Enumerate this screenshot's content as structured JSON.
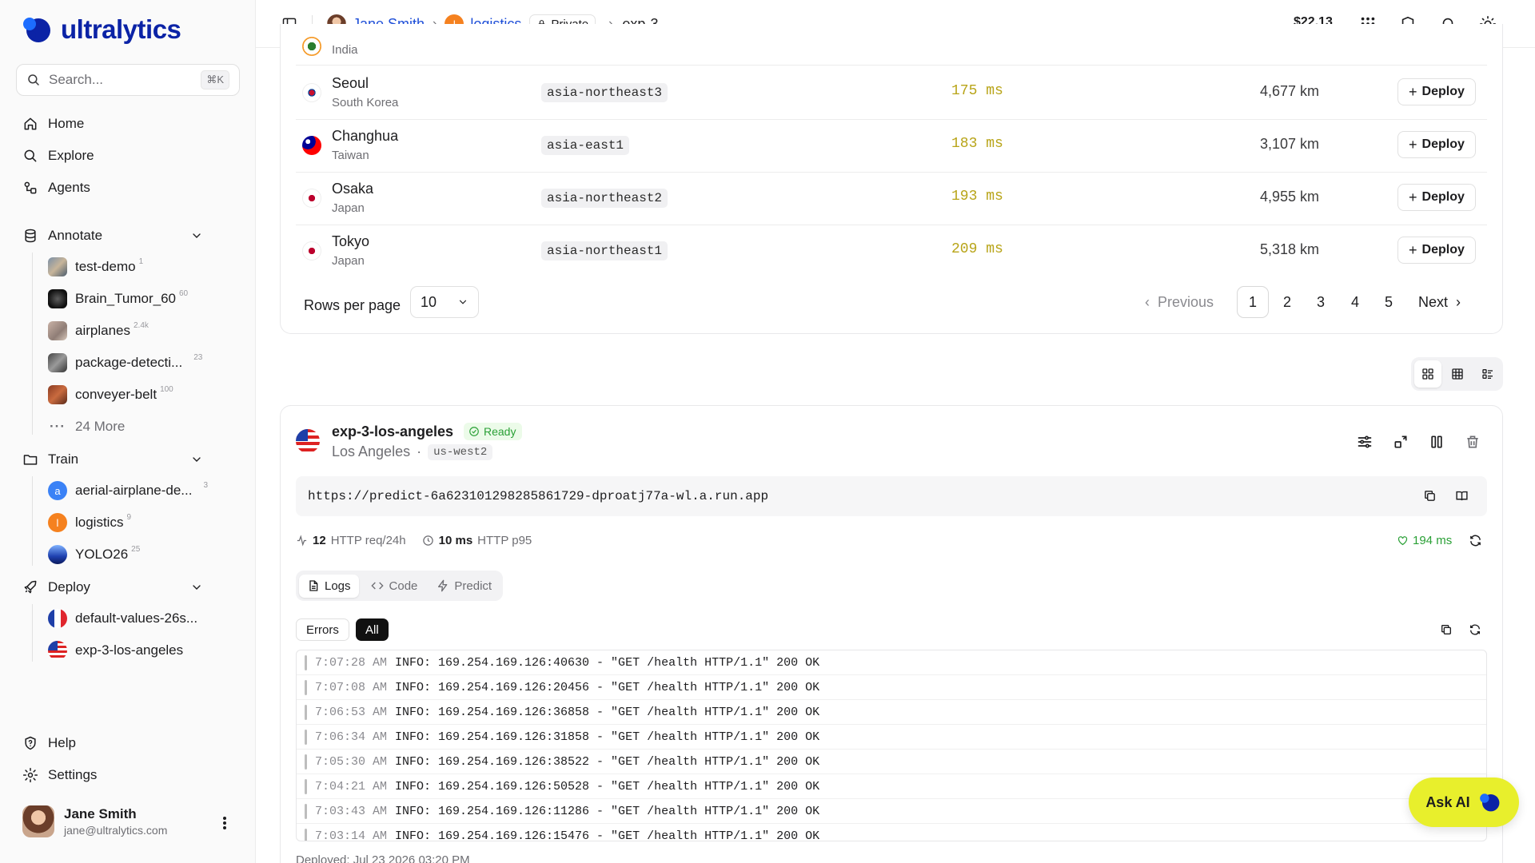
{
  "brand": {
    "name": "ultralytics"
  },
  "search": {
    "placeholder": "Search...",
    "shortcut": "⌘K"
  },
  "nav": {
    "home": "Home",
    "explore": "Explore",
    "agents": "Agents",
    "annotate": "Annotate",
    "train": "Train",
    "deploy": "Deploy",
    "help": "Help",
    "settings": "Settings"
  },
  "annotate_items": [
    {
      "label": "test-demo",
      "count": "1"
    },
    {
      "label": "Brain_Tumor_60",
      "count": "60"
    },
    {
      "label": "airplanes",
      "count": "2.4k"
    },
    {
      "label": "package-detecti...",
      "count": "23"
    },
    {
      "label": "conveyer-belt",
      "count": "100"
    },
    {
      "label": "24 More",
      "count": ""
    }
  ],
  "train_items": [
    {
      "label": "aerial-airplane-de...",
      "count": "3",
      "initial": "a"
    },
    {
      "label": "logistics",
      "count": "9",
      "initial": "l"
    },
    {
      "label": "YOLO26",
      "count": "25",
      "initial": ""
    }
  ],
  "deploy_items": [
    {
      "label": "default-values-26s..."
    },
    {
      "label": "exp-3-los-angeles"
    }
  ],
  "user": {
    "name": "Jane Smith",
    "email": "jane@ultralytics.com"
  },
  "breadcrumb": {
    "user": "Jane Smith",
    "project": "logistics",
    "project_initial": "l",
    "visibility": "Private",
    "current": "exp-3"
  },
  "topbar": {
    "balance": "$22.13"
  },
  "regions": [
    {
      "city": "",
      "country": "India",
      "zone": "",
      "latency": "",
      "distance": "",
      "deploy": "Deploy"
    },
    {
      "city": "Seoul",
      "country": "South Korea",
      "zone": "asia-northeast3",
      "latency": "175 ms",
      "distance": "4,677 km",
      "deploy": "Deploy"
    },
    {
      "city": "Changhua",
      "country": "Taiwan",
      "zone": "asia-east1",
      "latency": "183 ms",
      "distance": "3,107 km",
      "deploy": "Deploy"
    },
    {
      "city": "Osaka",
      "country": "Japan",
      "zone": "asia-northeast2",
      "latency": "193 ms",
      "distance": "4,955 km",
      "deploy": "Deploy"
    },
    {
      "city": "Tokyo",
      "country": "Japan",
      "zone": "asia-northeast1",
      "latency": "209 ms",
      "distance": "5,318 km",
      "deploy": "Deploy"
    }
  ],
  "pagination": {
    "rows_label": "Rows per page",
    "rows_value": "10",
    "previous": "Previous",
    "next": "Next",
    "pages": [
      "1",
      "2",
      "3",
      "4",
      "5"
    ],
    "current": "1"
  },
  "deployment": {
    "name": "exp-3-los-angeles",
    "status": "Ready",
    "location": "Los Angeles",
    "separator": "·",
    "region": "us-west2",
    "url": "https://predict-6a623101298285861729-dproatj77a-wl.a.run.app",
    "requests_value": "12",
    "requests_label": "HTTP req/24h",
    "p95_value": "10 ms",
    "p95_label": "HTTP p95",
    "latency": "194 ms",
    "tabs": [
      "Logs",
      "Code",
      "Predict"
    ],
    "active_tab": "Logs",
    "filters": [
      "Errors",
      "All"
    ],
    "active_filter": "All",
    "logs": [
      {
        "time": "7:07:28 AM",
        "msg": "INFO: 169.254.169.126:40630 - \"GET /health HTTP/1.1\" 200 OK"
      },
      {
        "time": "7:07:08 AM",
        "msg": "INFO: 169.254.169.126:20456 - \"GET /health HTTP/1.1\" 200 OK"
      },
      {
        "time": "7:06:53 AM",
        "msg": "INFO: 169.254.169.126:36858 - \"GET /health HTTP/1.1\" 200 OK"
      },
      {
        "time": "7:06:34 AM",
        "msg": "INFO: 169.254.169.126:31858 - \"GET /health HTTP/1.1\" 200 OK"
      },
      {
        "time": "7:05:30 AM",
        "msg": "INFO: 169.254.169.126:38522 - \"GET /health HTTP/1.1\" 200 OK"
      },
      {
        "time": "7:04:21 AM",
        "msg": "INFO: 169.254.169.126:50528 - \"GET /health HTTP/1.1\" 200 OK"
      },
      {
        "time": "7:03:43 AM",
        "msg": "INFO: 169.254.169.126:11286 - \"GET /health HTTP/1.1\" 200 OK"
      },
      {
        "time": "7:03:14 AM",
        "msg": "INFO: 169.254.169.126:15476 - \"GET /health HTTP/1.1\" 200 OK"
      }
    ],
    "deployed": "Deployed: Jul 23 2026 03:20 PM"
  },
  "ask_ai": "Ask AI",
  "colors": {
    "brand": "#0b23a6",
    "link": "#1d4ed8",
    "latency": "#b8a418",
    "ready": "#2aa036",
    "ask_ai": "#e8ef2c",
    "project_badge": "#f5811f"
  }
}
